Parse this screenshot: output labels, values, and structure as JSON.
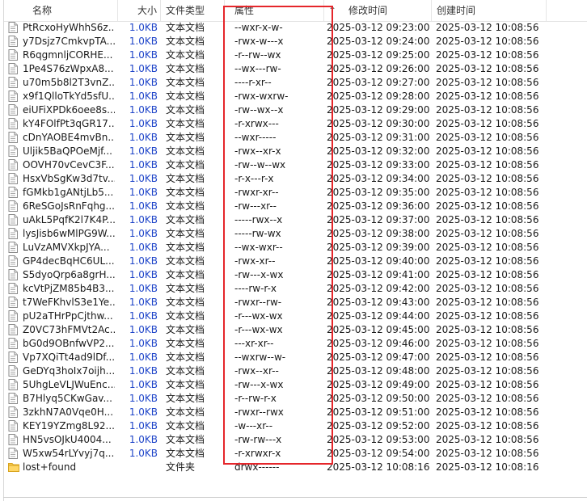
{
  "columns": {
    "name": "名称",
    "size": "大小",
    "type": "文件类型",
    "attr": "属性",
    "modified": "修改时间",
    "created": "创建时间"
  },
  "colors": {
    "size_text": "#1f45c9",
    "highlight_box": "#e5262b"
  },
  "rows": [
    {
      "name": "PtRcxoHyWhhS6z...",
      "size": "1.0KB",
      "type": "文本文档",
      "attr": "--wxr-x-w-",
      "modified": "2025-03-12 09:23:00",
      "created": "2025-03-12 10:08:56",
      "icon": "text-file-icon"
    },
    {
      "name": "y7Dsjz7CmkvpTA...",
      "size": "1.0KB",
      "type": "文本文档",
      "attr": "-rwx-w---x",
      "modified": "2025-03-12 09:24:00",
      "created": "2025-03-12 10:08:56",
      "icon": "text-file-icon"
    },
    {
      "name": "R6qgmnljCORHE...",
      "size": "1.0KB",
      "type": "文本文档",
      "attr": "-r--rw--wx",
      "modified": "2025-03-12 09:25:00",
      "created": "2025-03-12 10:08:56",
      "icon": "text-file-icon"
    },
    {
      "name": "1Pe4S76zWpxA8...",
      "size": "1.0KB",
      "type": "文本文档",
      "attr": "--wx---rw-",
      "modified": "2025-03-12 09:26:00",
      "created": "2025-03-12 10:08:56",
      "icon": "text-file-icon"
    },
    {
      "name": "u70m5b8l2T3vnZ...",
      "size": "1.0KB",
      "type": "文本文档",
      "attr": "----r-xr--",
      "modified": "2025-03-12 09:27:00",
      "created": "2025-03-12 10:08:56",
      "icon": "text-file-icon"
    },
    {
      "name": "x9f1QlloTkYd5sfU...",
      "size": "1.0KB",
      "type": "文本文档",
      "attr": "-rwx-wxrw-",
      "modified": "2025-03-12 09:28:00",
      "created": "2025-03-12 10:08:56",
      "icon": "text-file-icon"
    },
    {
      "name": "eiUFiXPDk6oee8s...",
      "size": "1.0KB",
      "type": "文本文档",
      "attr": "-rw--wx--x",
      "modified": "2025-03-12 09:29:00",
      "created": "2025-03-12 10:08:56",
      "icon": "text-file-icon"
    },
    {
      "name": "kY4FOlfPt3qGR17...",
      "size": "1.0KB",
      "type": "文本文档",
      "attr": "-r-xrwx---",
      "modified": "2025-03-12 09:30:00",
      "created": "2025-03-12 10:08:56",
      "icon": "text-file-icon"
    },
    {
      "name": "cDnYAOBE4mvBn...",
      "size": "1.0KB",
      "type": "文本文档",
      "attr": "--wxr-----",
      "modified": "2025-03-12 09:31:00",
      "created": "2025-03-12 10:08:56",
      "icon": "text-file-icon"
    },
    {
      "name": "Uljik5BaQPOeMjf...",
      "size": "1.0KB",
      "type": "文本文档",
      "attr": "-rwx--xr-x",
      "modified": "2025-03-12 09:32:00",
      "created": "2025-03-12 10:08:56",
      "icon": "text-file-icon"
    },
    {
      "name": "OOVH70vCevC3F...",
      "size": "1.0KB",
      "type": "文本文档",
      "attr": "-rw--w--wx",
      "modified": "2025-03-12 09:33:00",
      "created": "2025-03-12 10:08:56",
      "icon": "text-file-icon"
    },
    {
      "name": "HsxVbSgKw3d7tv...",
      "size": "1.0KB",
      "type": "文本文档",
      "attr": "-r-x---r-x",
      "modified": "2025-03-12 09:34:00",
      "created": "2025-03-12 10:08:56",
      "icon": "text-file-icon"
    },
    {
      "name": "fGMkb1gANtjLb5...",
      "size": "1.0KB",
      "type": "文本文档",
      "attr": "-rwxr-xr--",
      "modified": "2025-03-12 09:35:00",
      "created": "2025-03-12 10:08:56",
      "icon": "text-file-icon"
    },
    {
      "name": "6ReSGoJsRnFqhg...",
      "size": "1.0KB",
      "type": "文本文档",
      "attr": "-rw---xr--",
      "modified": "2025-03-12 09:36:00",
      "created": "2025-03-12 10:08:56",
      "icon": "text-file-icon"
    },
    {
      "name": "uAkL5PqfK2l7K4P...",
      "size": "1.0KB",
      "type": "文本文档",
      "attr": "-----rwx--x",
      "modified": "2025-03-12 09:37:00",
      "created": "2025-03-12 10:08:56",
      "icon": "text-file-icon"
    },
    {
      "name": "lysJisb6wMlPG9W...",
      "size": "1.0KB",
      "type": "文本文档",
      "attr": "-----rw-wx",
      "modified": "2025-03-12 09:38:00",
      "created": "2025-03-12 10:08:56",
      "icon": "text-file-icon"
    },
    {
      "name": "LuVzAMVXkpJYA...",
      "size": "1.0KB",
      "type": "文本文档",
      "attr": "--wx-wxr--",
      "modified": "2025-03-12 09:39:00",
      "created": "2025-03-12 10:08:56",
      "icon": "text-file-icon"
    },
    {
      "name": "GP4decBqHC6UL...",
      "size": "1.0KB",
      "type": "文本文档",
      "attr": "-rwx-xr--",
      "modified": "2025-03-12 09:40:00",
      "created": "2025-03-12 10:08:56",
      "icon": "text-file-icon"
    },
    {
      "name": "S5dyoQrp6a8grH...",
      "size": "1.0KB",
      "type": "文本文档",
      "attr": "-rw---x-wx",
      "modified": "2025-03-12 09:41:00",
      "created": "2025-03-12 10:08:56",
      "icon": "text-file-icon"
    },
    {
      "name": "kcVtPjZM85b4B3...",
      "size": "1.0KB",
      "type": "文本文档",
      "attr": "----rw-r-x",
      "modified": "2025-03-12 09:42:00",
      "created": "2025-03-12 10:08:56",
      "icon": "text-file-icon"
    },
    {
      "name": "t7WeFKhvlS3e1Ye...",
      "size": "1.0KB",
      "type": "文本文档",
      "attr": "-rwxr--rw-",
      "modified": "2025-03-12 09:43:00",
      "created": "2025-03-12 10:08:56",
      "icon": "text-file-icon"
    },
    {
      "name": "pU2aTHrPpCjthw...",
      "size": "1.0KB",
      "type": "文本文档",
      "attr": "-r---wx-wx",
      "modified": "2025-03-12 09:44:00",
      "created": "2025-03-12 10:08:56",
      "icon": "text-file-icon"
    },
    {
      "name": "Z0VC73hFMVt2Ac...",
      "size": "1.0KB",
      "type": "文本文档",
      "attr": "-r---wx-wx",
      "modified": "2025-03-12 09:45:00",
      "created": "2025-03-12 10:08:56",
      "icon": "text-file-icon"
    },
    {
      "name": "bG0d9OBnfwVP2...",
      "size": "1.0KB",
      "type": "文本文档",
      "attr": "---xr-xr--",
      "modified": "2025-03-12 09:46:00",
      "created": "2025-03-12 10:08:56",
      "icon": "text-file-icon"
    },
    {
      "name": "Vp7XQiTt4ad9lDf...",
      "size": "1.0KB",
      "type": "文本文档",
      "attr": "--wxrw--w-",
      "modified": "2025-03-12 09:47:00",
      "created": "2025-03-12 10:08:56",
      "icon": "text-file-icon"
    },
    {
      "name": "GeDYq3hoIx7oijh...",
      "size": "1.0KB",
      "type": "文本文档",
      "attr": "-rwx--xr--",
      "modified": "2025-03-12 09:48:00",
      "created": "2025-03-12 10:08:56",
      "icon": "text-file-icon"
    },
    {
      "name": "5UhgLeVLJWuEnc...",
      "size": "1.0KB",
      "type": "文本文档",
      "attr": "-rw---x-wx",
      "modified": "2025-03-12 09:49:00",
      "created": "2025-03-12 10:08:56",
      "icon": "text-file-icon"
    },
    {
      "name": "B7Hlyq5CKwGav...",
      "size": "1.0KB",
      "type": "文本文档",
      "attr": "-r--rw-r-x",
      "modified": "2025-03-12 09:50:00",
      "created": "2025-03-12 10:08:56",
      "icon": "text-file-icon"
    },
    {
      "name": "3zkhN7A0Vqe0H...",
      "size": "1.0KB",
      "type": "文本文档",
      "attr": "-rwxr--rwx",
      "modified": "2025-03-12 09:51:00",
      "created": "2025-03-12 10:08:56",
      "icon": "text-file-icon"
    },
    {
      "name": "KEY19YZmg8L92...",
      "size": "1.0KB",
      "type": "文本文档",
      "attr": "-w---xr--",
      "modified": "2025-03-12 09:52:00",
      "created": "2025-03-12 10:08:56",
      "icon": "text-file-icon"
    },
    {
      "name": "HN5vsOJkU4004...",
      "size": "1.0KB",
      "type": "文本文档",
      "attr": "-rw-rw---x",
      "modified": "2025-03-12 09:53:00",
      "created": "2025-03-12 10:08:56",
      "icon": "text-file-icon"
    },
    {
      "name": "W5xw54rLYvyj7q...",
      "size": "1.0KB",
      "type": "文本文档",
      "attr": "-r-xrwxr-x",
      "modified": "2025-03-12 09:54:00",
      "created": "2025-03-12 10:08:56",
      "icon": "text-file-icon"
    },
    {
      "name": "lost+found",
      "size": "",
      "type": "文件夹",
      "attr": "drwx------",
      "modified": "2025-03-12 10:08:16",
      "created": "2025-03-12 10:08:16",
      "icon": "folder-icon"
    }
  ]
}
